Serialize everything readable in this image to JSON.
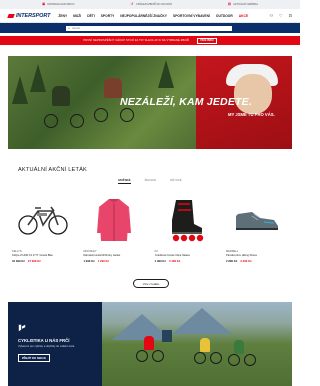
{
  "topbar": {
    "items": [
      {
        "icon": "truck-icon",
        "label": "DOPRAVA NAD 999 Kč"
      },
      {
        "icon": "return-icon",
        "label": "VRÁCENÍ ZBOŽÍ DO 100 DNŮ"
      },
      {
        "icon": "store-icon",
        "label": "AKTUÁLNÍ NABÍDKA"
      }
    ]
  },
  "header": {
    "logo": "INTERSPORT",
    "nav": [
      "ŽENY",
      "MUŽI",
      "DĚTI",
      "SPORTY",
      "NEJPOPULÁRNĚJŠÍ ZNAČKY",
      "SPORTOVNÍ VYBAVENÍ",
      "OUTDOOR",
      "AKCE"
    ],
    "icons": [
      "user-icon",
      "heart-icon",
      "cart-icon"
    ]
  },
  "search": {
    "placeholder": "Hledat"
  },
  "promo": {
    "text": "PRVNÍ NEPROSPĚŠNÝ NÁKUP STOJÍ ZA TO! SLEVA 20 % NA VYBRANÉ ZBOŽÍ",
    "code": "VÍCE INFO"
  },
  "hero": {
    "headline": "NEZÁLEŽÍ, KAM JEDETE.",
    "subheadline": "MY JSME TU PRO VÁS."
  },
  "leaflet": {
    "title": "AKTUÁLNÍ AKČNÍ LETÁK",
    "tabs": [
      "MUŽSKÉ",
      "ŽENSKÉ",
      "DĚTSKÉ"
    ],
    "products": [
      {
        "brand": "Kellys",
        "name": "Kellys eTHOR 10 27.5\" Gravel Bike",
        "old_price": "34 999 Kč",
        "new_price": "27 999 Kč",
        "icon": "bike-icon"
      },
      {
        "brand": "McKinley",
        "name": "Dámská bunda McKinley Jacket",
        "old_price": "1 999 Kč",
        "new_price": "1 299 Kč",
        "icon": "jacket-icon"
      },
      {
        "brand": "K2",
        "name": "Kolečkové brusle Inline Skates",
        "old_price": "4 999 Kč",
        "new_price": "3 499 Kč",
        "icon": "skates-icon"
      },
      {
        "brand": "Merrell",
        "name": "Pánská obuv Hiking Shoes",
        "old_price": "2 899 Kč",
        "new_price": "2 299 Kč",
        "icon": "shoe-icon"
      }
    ],
    "more_label": "Více z letáku"
  },
  "banner": {
    "title": "CYKLISTIKA U NÁS FRČÍ",
    "subtitle": "Vybavení pro cyklisty a doplňky do vašeho kola",
    "button": "PŘEJÍT DO SEKCE"
  },
  "colors": {
    "brand_red": "#e30613",
    "brand_navy": "#0a2f6b"
  }
}
